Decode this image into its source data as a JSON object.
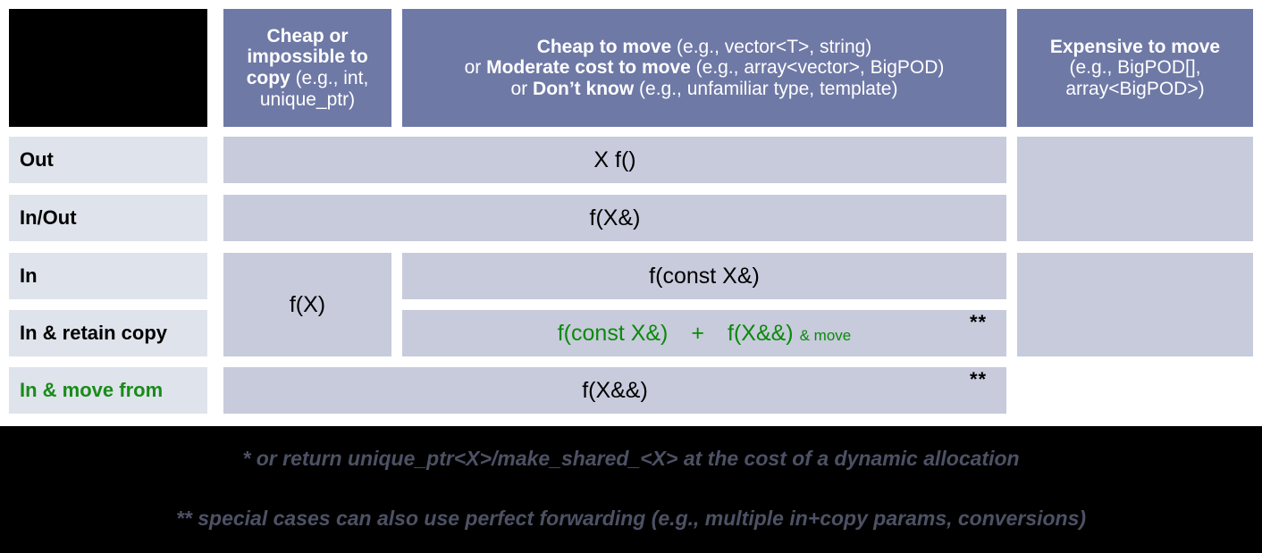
{
  "title": "C++ parameter passing guidance table",
  "colors": {
    "header_bg": "#6f79a6",
    "row_label_bg": "#dfe3ec",
    "body_cell_bg": "#c7cbdb",
    "accent_green": "#0a8a0a",
    "label_green": "#188c18",
    "footer_bg": "#000000",
    "footnote_text": "#4d5164",
    "corner_bg": "#000000"
  },
  "header": {
    "corner": "",
    "columns": [
      {
        "id": "cheap-or-impossible-to-copy",
        "lines": [
          {
            "bold": "Cheap or",
            "light": ""
          },
          {
            "bold": "impossible to",
            "light": ""
          },
          {
            "bold": "copy",
            "light": " (e.g., int,"
          },
          {
            "bold": "",
            "light": "unique_ptr)"
          }
        ]
      },
      {
        "id": "cheap-to-move",
        "lines": [
          {
            "bold": "Cheap to move",
            "light": " (e.g., vector<T>, string)"
          },
          {
            "bold": "Moderate cost to move",
            "light": " (e.g., array<vector>, BigPOD)",
            "prefix": "or "
          },
          {
            "bold": "Don’t know",
            "light": " (e.g., unfamiliar type, template)",
            "prefix": "or "
          }
        ]
      },
      {
        "id": "expensive-to-move",
        "lines": [
          {
            "bold": "Expensive to move",
            "light": ""
          },
          {
            "bold": "",
            "light": "(e.g., BigPOD[],"
          },
          {
            "bold": "",
            "light": "array<BigPOD>)"
          }
        ]
      }
    ]
  },
  "rows": [
    {
      "id": "out",
      "label": "Out",
      "green_label": false
    },
    {
      "id": "in-out",
      "label": "In/Out",
      "green_label": false
    },
    {
      "id": "in",
      "label": "In",
      "green_label": false
    },
    {
      "id": "in-retain-copy",
      "label": "In & retain copy",
      "green_label": false
    },
    {
      "id": "in-move-from",
      "label": "In & move from",
      "green_label": true
    }
  ],
  "cells": {
    "out_wide": "X f()",
    "in_out_wide": "f(X&)",
    "in_copy_span": "f(X)",
    "in_const_ref": "f(const X&)",
    "retain_copy_a": "f(const X&)",
    "retain_copy_plus": "+",
    "retain_copy_b": "f(X&&)",
    "retain_copy_move": "& move",
    "move_from": "f(X&&)",
    "stars_retain_copy": "**",
    "stars_move_from": "**"
  },
  "footnotes": [
    "* or return unique_ptr<X>/make_shared_<X> at the cost of a dynamic allocation",
    "** special cases can also use perfect forwarding (e.g., multiple in+copy params, conversions)"
  ]
}
